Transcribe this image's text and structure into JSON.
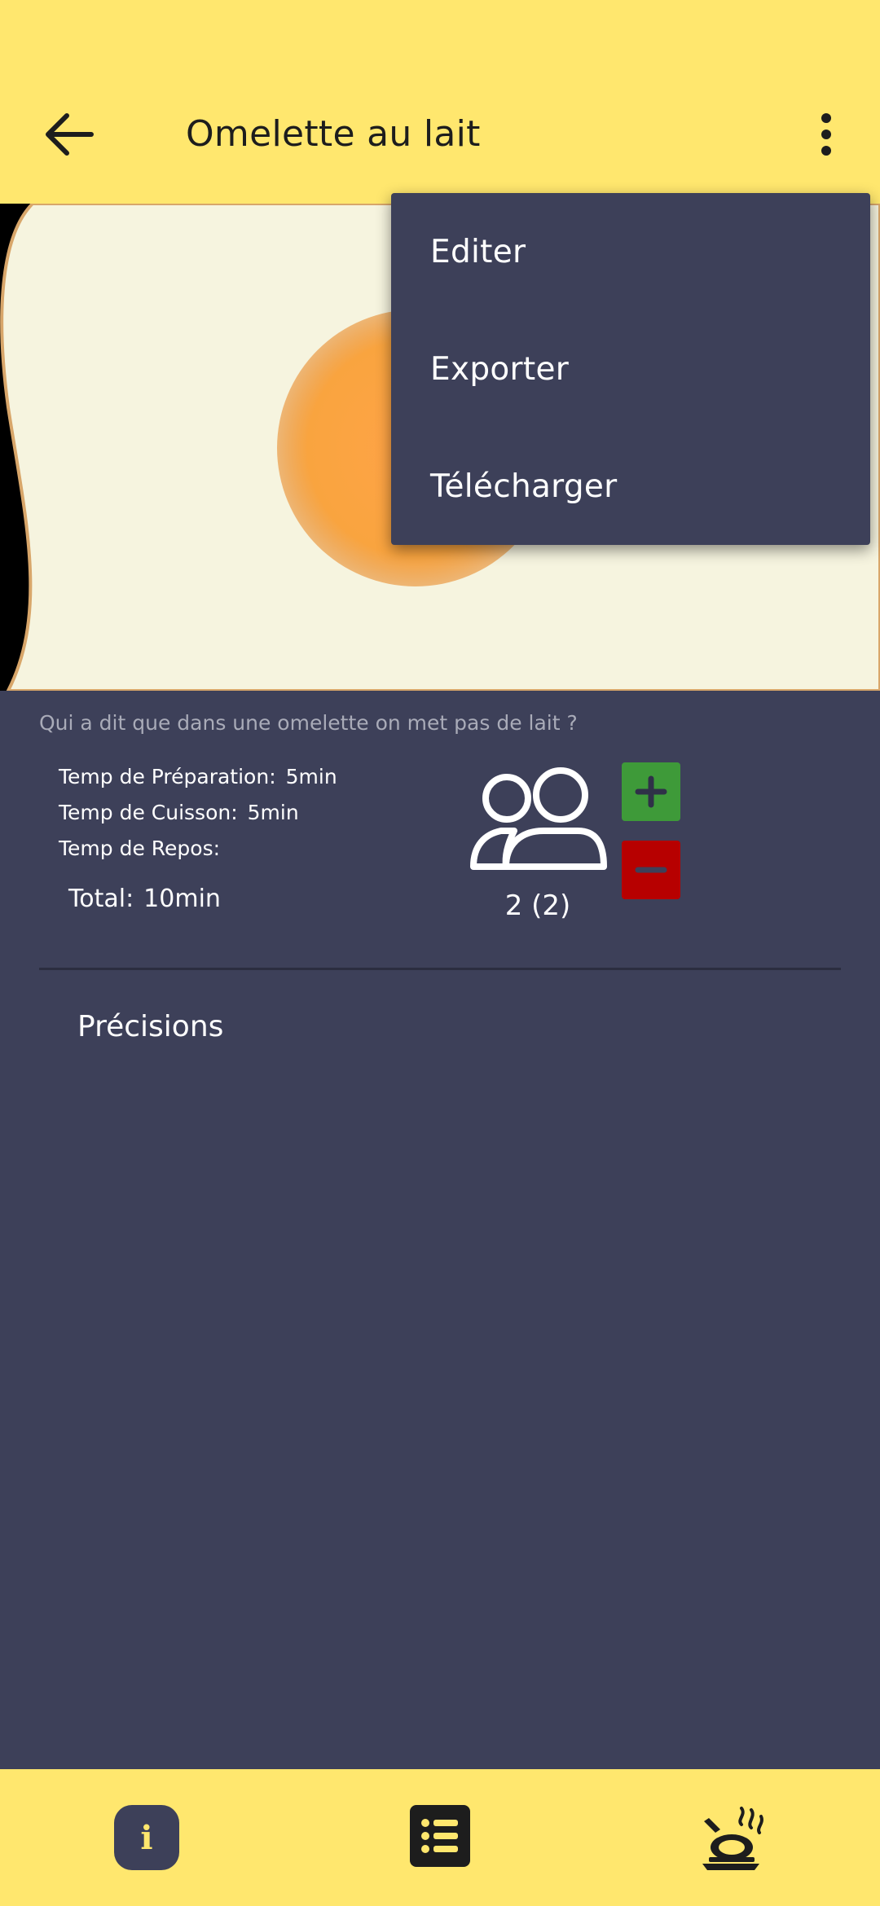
{
  "header": {
    "title": "Omelette au lait",
    "back_icon": "arrow-left-icon",
    "more_icon": "more-vertical-icon",
    "background": "#ffe76e"
  },
  "menu": {
    "items": [
      "Editer",
      "Exporter",
      "Télécharger"
    ]
  },
  "recipe": {
    "description": "Qui a dit que dans une omelette on met pas de lait ?",
    "times": {
      "prep_label": "Temp de Préparation:",
      "prep_value": "5min",
      "cook_label": "Temp de Cuisson:",
      "cook_value": "5min",
      "rest_label": "Temp de Repos:",
      "rest_value": "",
      "total_label": "Total:",
      "total_value": "10min"
    },
    "servings": {
      "count_text": "2 (2)",
      "icon": "people-icon",
      "plus_color": "#3e9a39",
      "minus_color": "#b70000"
    },
    "section_title": "Précisions"
  },
  "bottom_nav": {
    "items": [
      "info-icon",
      "list-icon",
      "cooking-icon"
    ]
  }
}
